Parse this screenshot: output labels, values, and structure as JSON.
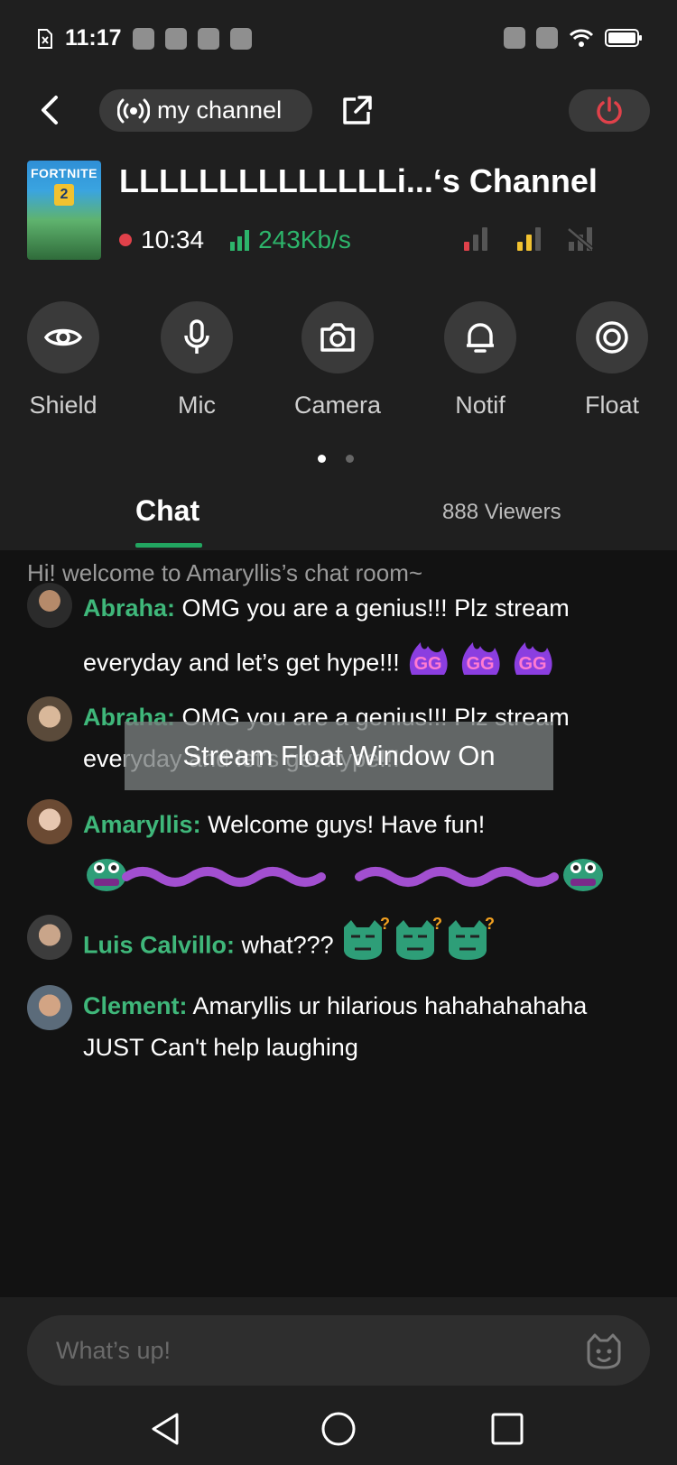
{
  "status_bar": {
    "time": "11:17"
  },
  "header": {
    "channel_pill_label": "my channel",
    "channel_title": "LLLLLLLLLLLLLLi...‘s Channel",
    "stream_time": "10:34",
    "bitrate": "243Kb/s",
    "cover_brand": "FORTNITE",
    "cover_chapter": "2"
  },
  "actions": [
    {
      "label": "Shield",
      "icon": "eye-icon"
    },
    {
      "label": "Mic",
      "icon": "mic-icon"
    },
    {
      "label": "Camera",
      "icon": "camera-icon"
    },
    {
      "label": "Notif",
      "icon": "bell-icon"
    },
    {
      "label": "Float",
      "icon": "float-icon"
    }
  ],
  "pager": {
    "pages": 2,
    "active": 1
  },
  "tabs": {
    "chat": "Chat",
    "viewers": "888 Viewers"
  },
  "chat": {
    "welcome": "Hi! welcome to Amaryllis’s chat room~",
    "messages": [
      {
        "user": "Abraha:",
        "text": "OMG you are a genius!!! Plz stream everyday and let’s get hype!!!",
        "emotes": "GG x3"
      },
      {
        "user": "Abraha:",
        "text": "OMG you are a genius!!! Plz stream everyday and let’s get hype!!!"
      },
      {
        "user": "Amaryllis:",
        "text": "Welcome guys! Have fun!",
        "emotes": "snake"
      },
      {
        "user": "Luis Calvillo:",
        "text": "what???",
        "emotes": "confused x3"
      },
      {
        "user": "Clement:",
        "text": "Amaryllis ur hilarious hahahahahaha JUST Can't help laughing"
      }
    ]
  },
  "toast": "Stream Float Window On",
  "input": {
    "placeholder": "What’s up!"
  },
  "colors": {
    "accent": "#22a560",
    "username": "#3fb77a",
    "live": "#e0414a",
    "power": "#e0414a"
  }
}
